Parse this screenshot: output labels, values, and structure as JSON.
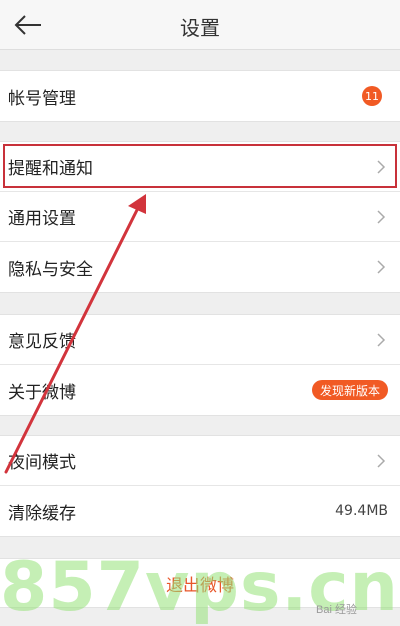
{
  "header": {
    "title": "设置",
    "back_icon": "arrow-left-icon"
  },
  "sections": {
    "account": {
      "label": "帐号管理",
      "badge": "11"
    },
    "general": [
      {
        "label": "提醒和通知"
      },
      {
        "label": "通用设置"
      },
      {
        "label": "隐私与安全"
      }
    ],
    "about": [
      {
        "label": "意见反馈"
      },
      {
        "label": "关于微博",
        "badge": "发现新版本"
      }
    ],
    "misc": [
      {
        "label": "夜间模式"
      },
      {
        "label": "清除缓存",
        "value": "49.4MB"
      }
    ]
  },
  "logout": {
    "label": "退出微博"
  },
  "overlays": {
    "watermark": "857vps.cn",
    "baidu_watermark": "Bai 经验"
  },
  "colors": {
    "accent": "#f15a24",
    "annotation_red": "#c8313a",
    "background": "#efefef"
  }
}
